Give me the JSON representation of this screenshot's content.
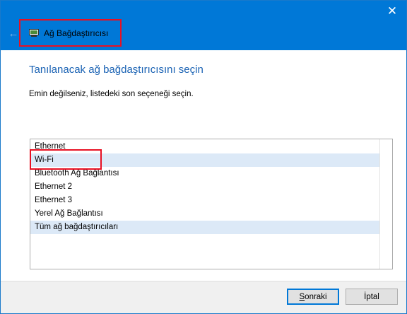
{
  "window": {
    "title": "Ağ Bağdaştırıcısı",
    "close_glyph": "✕",
    "back_glyph": "←",
    "accent_color": "#0078d7",
    "highlight_color": "#e81123"
  },
  "main": {
    "heading": "Tanılanacak ağ bağdaştırıcısını seçin",
    "instruction": "Emin değilseniz, listedeki son seçeneği seçin.",
    "adapters": [
      {
        "label": "Ethernet"
      },
      {
        "label": "Wi-Fi"
      },
      {
        "label": "Bluetooth Ağ Bağlantısı"
      },
      {
        "label": "Ethernet 2"
      },
      {
        "label": "Ethernet 3"
      },
      {
        "label": "Yerel Ağ Bağlantısı"
      },
      {
        "label": "Tüm ağ bağdaştırıcıları"
      }
    ]
  },
  "footer": {
    "next_label": "Sonraki",
    "cancel_label": "İptal"
  }
}
